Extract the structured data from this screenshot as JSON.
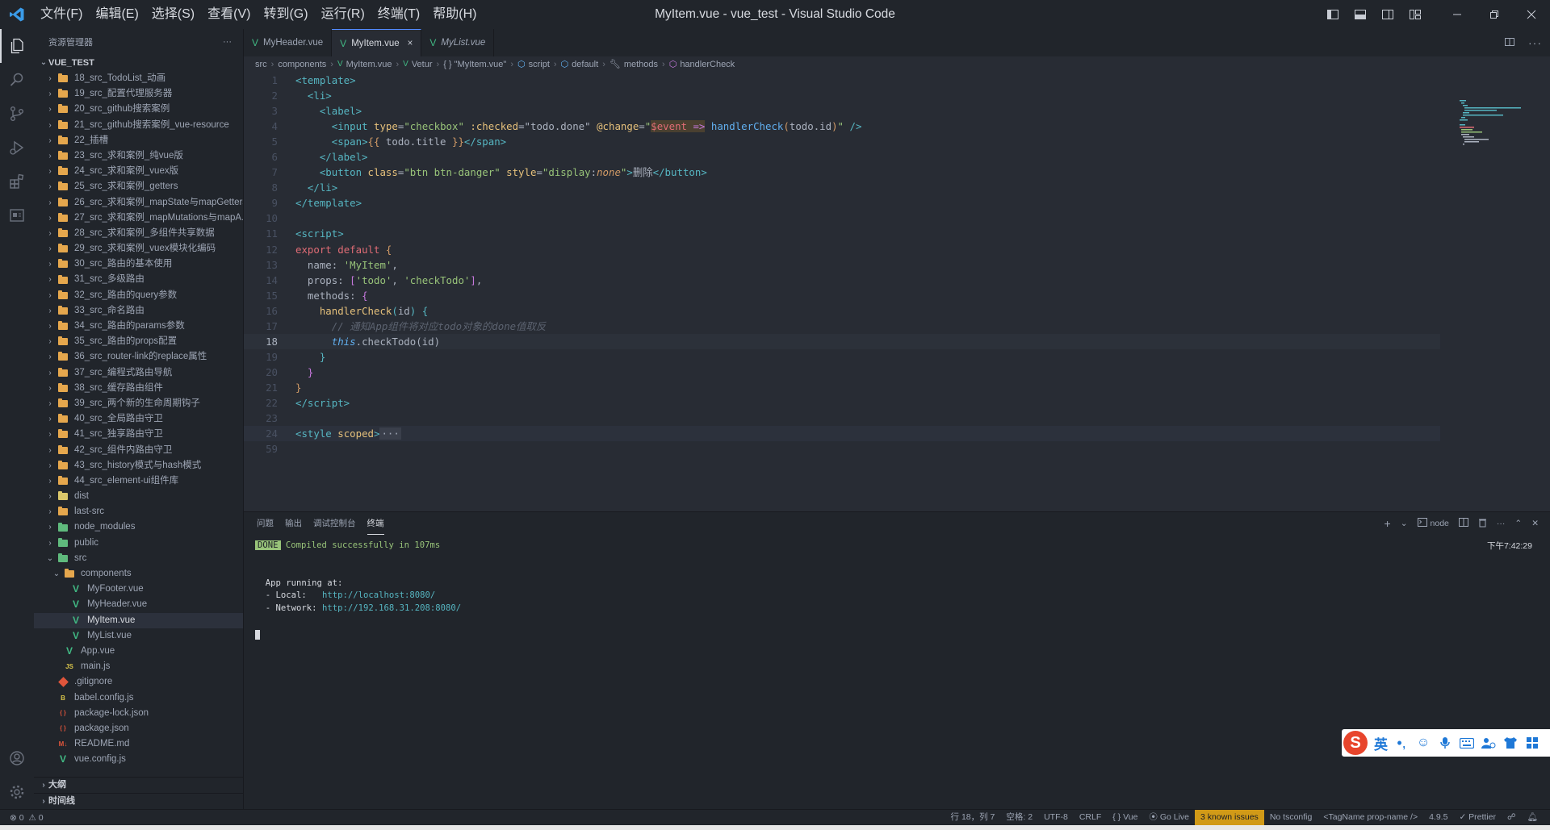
{
  "window": {
    "title": "MyItem.vue - vue_test - Visual Studio Code",
    "menu": [
      "文件(F)",
      "编辑(E)",
      "选择(S)",
      "查看(V)",
      "转到(G)",
      "运行(R)",
      "终端(T)",
      "帮助(H)"
    ]
  },
  "sidebar": {
    "title": "资源管理器",
    "more": "···",
    "root": "VUE_TEST",
    "tree": [
      {
        "label": "18_src_TodoList_动画",
        "type": "folder"
      },
      {
        "label": "19_src_配置代理服务器",
        "type": "folder"
      },
      {
        "label": "20_src_github搜索案例",
        "type": "folder"
      },
      {
        "label": "21_src_github搜索案例_vue-resource",
        "type": "folder"
      },
      {
        "label": "22_插槽",
        "type": "folder"
      },
      {
        "label": "23_src_求和案例_纯vue版",
        "type": "folder"
      },
      {
        "label": "24_src_求和案例_vuex版",
        "type": "folder"
      },
      {
        "label": "25_src_求和案例_getters",
        "type": "folder"
      },
      {
        "label": "26_src_求和案例_mapState与mapGetters",
        "type": "folder"
      },
      {
        "label": "27_src_求和案例_mapMutations与mapA...",
        "type": "folder"
      },
      {
        "label": "28_src_求和案例_多组件共享数据",
        "type": "folder"
      },
      {
        "label": "29_src_求和案例_vuex模块化编码",
        "type": "folder"
      },
      {
        "label": "30_src_路由的基本使用",
        "type": "folder"
      },
      {
        "label": "31_src_多级路由",
        "type": "folder"
      },
      {
        "label": "32_src_路由的query参数",
        "type": "folder"
      },
      {
        "label": "33_src_命名路由",
        "type": "folder"
      },
      {
        "label": "34_src_路由的params参数",
        "type": "folder"
      },
      {
        "label": "35_src_路由的props配置",
        "type": "folder"
      },
      {
        "label": "36_src_router-link的replace属性",
        "type": "folder"
      },
      {
        "label": "37_src_编程式路由导航",
        "type": "folder"
      },
      {
        "label": "38_src_缓存路由组件",
        "type": "folder"
      },
      {
        "label": "39_src_两个新的生命周期钩子",
        "type": "folder"
      },
      {
        "label": "40_src_全局路由守卫",
        "type": "folder"
      },
      {
        "label": "41_src_独享路由守卫",
        "type": "folder"
      },
      {
        "label": "42_src_组件内路由守卫",
        "type": "folder"
      },
      {
        "label": "43_src_history模式与hash模式",
        "type": "folder"
      },
      {
        "label": "44_src_element-ui组件库",
        "type": "folder"
      },
      {
        "label": "dist",
        "type": "folder-y"
      },
      {
        "label": "last-src",
        "type": "folder"
      },
      {
        "label": "node_modules",
        "type": "folder-g"
      },
      {
        "label": "public",
        "type": "folder-g"
      },
      {
        "label": "src",
        "type": "folder-g-open"
      },
      {
        "label": "components",
        "type": "folder-open",
        "indent": 1
      },
      {
        "label": "MyFooter.vue",
        "type": "vue",
        "indent": 2
      },
      {
        "label": "MyHeader.vue",
        "type": "vue",
        "indent": 2
      },
      {
        "label": "MyItem.vue",
        "type": "vue",
        "indent": 2,
        "selected": true
      },
      {
        "label": "MyList.vue",
        "type": "vue",
        "indent": 2
      },
      {
        "label": "App.vue",
        "type": "vue",
        "indent": 1
      },
      {
        "label": "main.js",
        "type": "js",
        "indent": 1
      },
      {
        "label": ".gitignore",
        "type": "git"
      },
      {
        "label": "babel.config.js",
        "type": "babel"
      },
      {
        "label": "package-lock.json",
        "type": "json"
      },
      {
        "label": "package.json",
        "type": "json"
      },
      {
        "label": "README.md",
        "type": "md"
      },
      {
        "label": "vue.config.js",
        "type": "vue"
      }
    ],
    "sections": [
      "大纲",
      "时间线"
    ]
  },
  "tabs": [
    {
      "label": "MyHeader.vue",
      "active": false
    },
    {
      "label": "MyItem.vue",
      "active": true,
      "close": "×"
    },
    {
      "label": "MyList.vue",
      "active": false,
      "italic": true
    }
  ],
  "breadcrumb": [
    "src",
    "components",
    "MyItem.vue",
    "Vetur",
    "{ } \"MyItem.vue\"",
    "script",
    "default",
    "methods",
    "handlerCheck"
  ],
  "code": {
    "line_numbers": [
      "1",
      "2",
      "3",
      "4",
      "5",
      "6",
      "7",
      "8",
      "9",
      "10",
      "11",
      "12",
      "13",
      "14",
      "15",
      "16",
      "17",
      "18",
      "19",
      "20",
      "21",
      "22",
      "23",
      "24",
      "59"
    ],
    "current_line": "18"
  },
  "panel": {
    "tabs": [
      "问题",
      "输出",
      "调试控制台",
      "终端"
    ],
    "active_tab": "终端",
    "terminal_name": "node",
    "time": "下午7:42:29",
    "lines": {
      "done_badge": "DONE",
      "compiled": " Compiled successfully in 107ms",
      "running": "App running at:",
      "local_label": "- Local:   ",
      "local_url": "http://localhost:8080/",
      "network_label": "- Network: ",
      "network_url": "http://192.168.31.208:8080/"
    }
  },
  "ime": {
    "logo": "S",
    "lang": "英"
  },
  "statusbar": {
    "errors": "0",
    "warnings": "0",
    "position": "行 18，列 7",
    "spaces": "空格: 2",
    "encoding": "UTF-8",
    "eol": "CRLF",
    "language": "Vue",
    "golive": "Go Live",
    "issues": "3 known issues",
    "tsconfig": "No tsconfig",
    "tagname": "<TagName prop-name />",
    "version": "4.9.5",
    "prettier": "Prettier"
  },
  "colors": {
    "accent": "#528bff",
    "warn": "#d19a17",
    "vue": "#41b883",
    "folder": "#e5a74d"
  }
}
